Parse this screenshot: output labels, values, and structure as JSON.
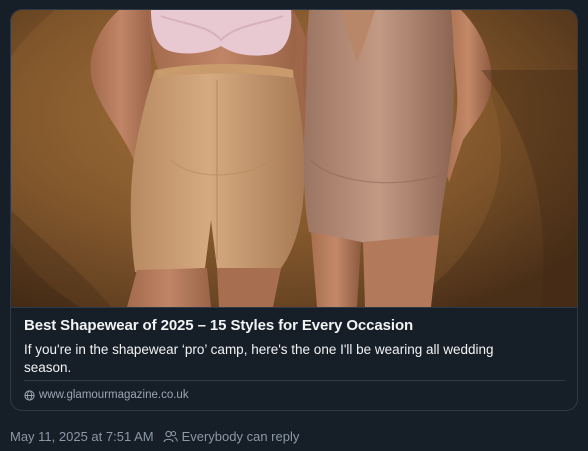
{
  "link_card": {
    "image_alt": "Two women wearing nude shapewear shorts and bodysuits",
    "title": "Best Shapewear of 2025 – 15 Styles for Every Occasion",
    "description": "If you're in the shapewear ‘pro’ camp, here's the one I'll be wearing all wedding season.",
    "domain": "www.glamourmagazine.co.uk",
    "domain_icon": "globe-icon"
  },
  "post_meta": {
    "timestamp": "May 11, 2025 at 7:51 AM",
    "reply_setting": "Everybody can reply",
    "reply_icon": "people-icon"
  },
  "colors": {
    "background": "#161e27",
    "border": "#2e3a48",
    "text_primary": "#f1f3f5",
    "text_secondary": "#8c98a6"
  }
}
